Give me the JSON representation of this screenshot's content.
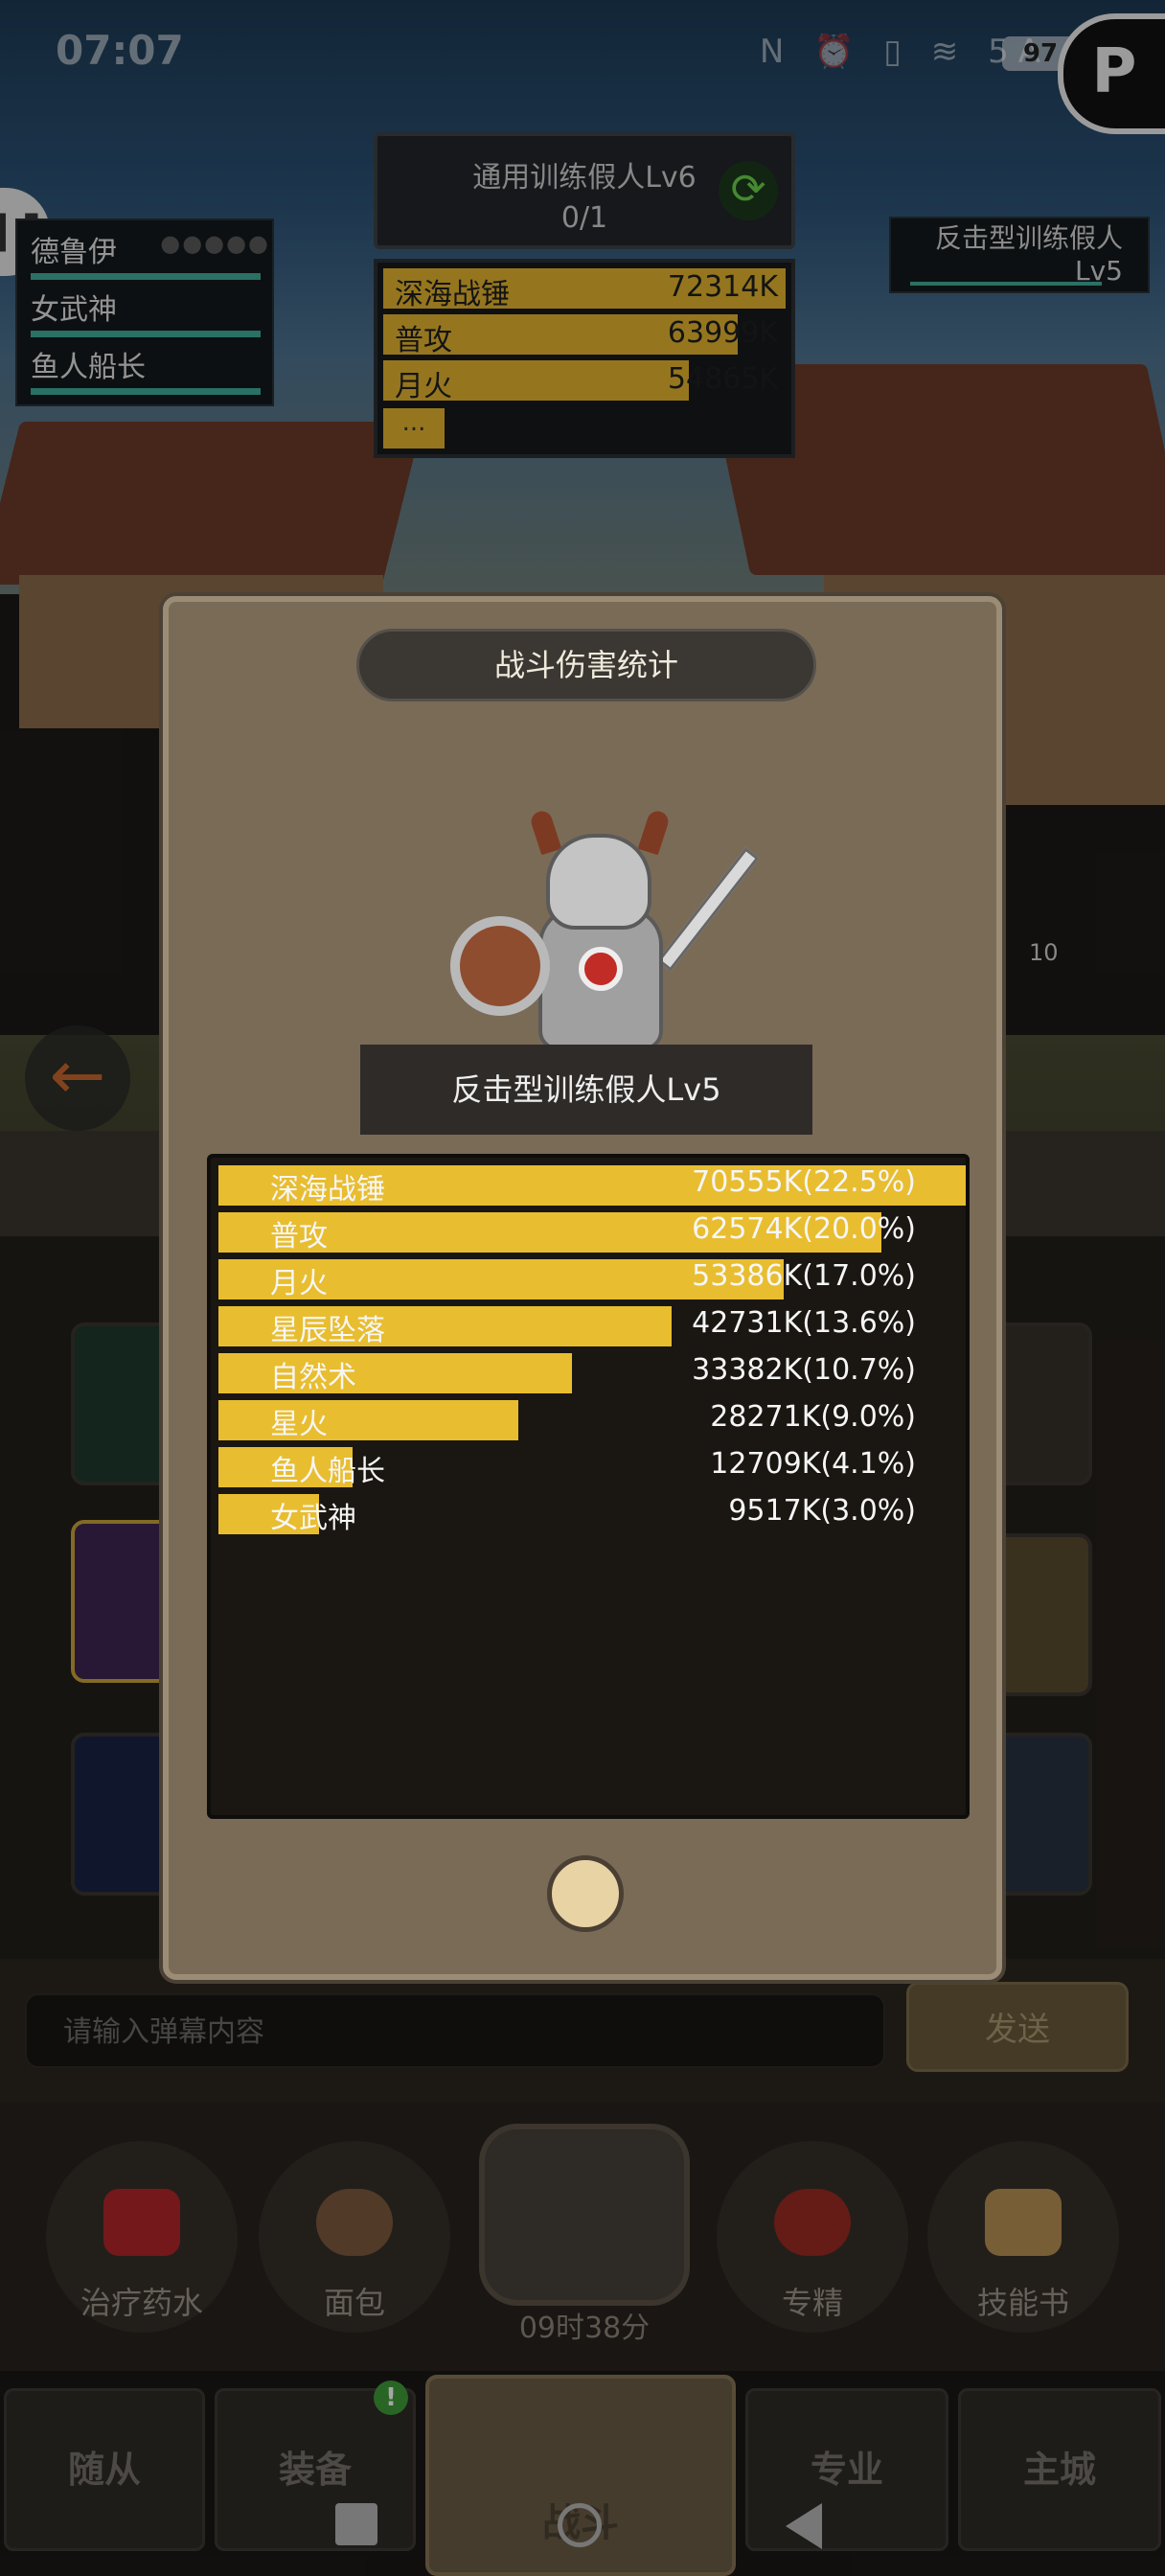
{
  "status_bar": {
    "time": "07:07",
    "icons_text": "N ⏰ ▯ ≋ 5A",
    "battery": "97"
  },
  "hud": {
    "target_title": "通用训练假人Lv6",
    "target_progress": "0/1",
    "mini_damage": [
      {
        "name": "深海战锤",
        "value": "72314K",
        "fraction": 1.0
      },
      {
        "name": "普攻",
        "value": "63999K",
        "fraction": 0.88
      },
      {
        "name": "月火",
        "value": "54865K",
        "fraction": 0.76
      }
    ],
    "mini_more": "...",
    "party": [
      {
        "name": "德鲁伊",
        "dots": "●●●●●"
      },
      {
        "name": "女武神"
      },
      {
        "name": "鱼人船长"
      }
    ],
    "enemy_name_line1": "反击型训练假人",
    "enemy_name_line2": "Lv5",
    "enemy_hp_number": "10"
  },
  "dialog": {
    "title": "战斗伤害统计",
    "target_name": "反击型训练假人Lv5",
    "stats": [
      {
        "name": "深海战锤",
        "value": "70555K(22.5%)",
        "fraction": 1.0
      },
      {
        "name": "普攻",
        "value": "62574K(20.0%)",
        "fraction": 0.887
      },
      {
        "name": "月火",
        "value": "53386K(17.0%)",
        "fraction": 0.757
      },
      {
        "name": "星辰坠落",
        "value": "42731K(13.6%)",
        "fraction": 0.606
      },
      {
        "name": "自然术",
        "value": "33382K(10.7%)",
        "fraction": 0.473
      },
      {
        "name": "星火",
        "value": "28271K(9.0%)",
        "fraction": 0.401
      },
      {
        "name": "鱼人船长",
        "value": "12709K(4.1%)",
        "fraction": 0.18
      },
      {
        "name": "女武神",
        "value": "9517K(3.0%)",
        "fraction": 0.135
      }
    ]
  },
  "chat": {
    "placeholder": "请输入弹幕内容",
    "send_label": "发送"
  },
  "items": [
    {
      "label": "治疗药水"
    },
    {
      "label": "面包"
    },
    {
      "label": "专精"
    },
    {
      "label": "技能书"
    }
  ],
  "chest_timer": "09时38分",
  "nav": {
    "tabs": [
      "随从",
      "装备",
      "战斗",
      "专业",
      "主城"
    ],
    "badge": "!"
  },
  "colors": {
    "accent": "#e8bd2f",
    "hp": "#3fae9a",
    "dialog_bg": "#7a6b57"
  }
}
